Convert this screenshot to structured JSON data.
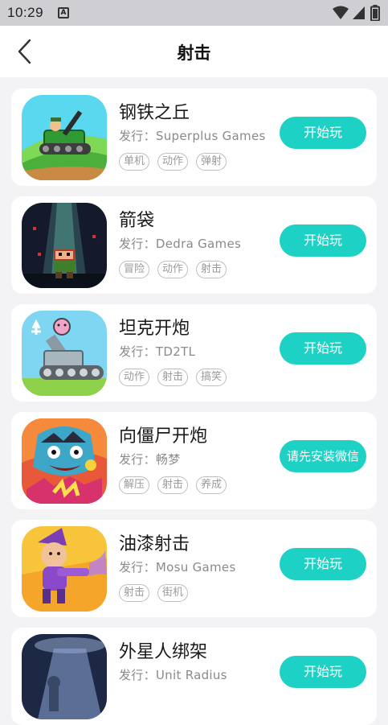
{
  "status": {
    "time": "10:29",
    "notif_letter": "A"
  },
  "nav": {
    "title": "射击"
  },
  "colors": {
    "accent": "#1dd2c4"
  },
  "games": [
    {
      "name": "钢铁之丘",
      "publisher": "发行：Superplus Games",
      "tags": [
        "单机",
        "动作",
        "弹射"
      ],
      "action": "开始玩",
      "icon": "tank-hill-icon"
    },
    {
      "name": "箭袋",
      "publisher": "发行：Dedra Games",
      "tags": [
        "冒险",
        "动作",
        "射击"
      ],
      "action": "开始玩",
      "icon": "pixel-hero-icon"
    },
    {
      "name": "坦克开炮",
      "publisher": "发行：TD2TL",
      "tags": [
        "动作",
        "射击",
        "搞笑"
      ],
      "action": "开始玩",
      "icon": "cannon-tank-icon"
    },
    {
      "name": "向僵尸开炮",
      "publisher": "发行：畅梦",
      "tags": [
        "解压",
        "射击",
        "养成"
      ],
      "action": "请先安装微信",
      "icon": "zombie-icon"
    },
    {
      "name": "油漆射击",
      "publisher": "发行：Mosu Games",
      "tags": [
        "射击",
        "街机"
      ],
      "action": "开始玩",
      "icon": "paint-shooter-icon"
    },
    {
      "name": "外星人绑架",
      "publisher": "发行：Unit Radius",
      "tags": [],
      "action": "开始玩",
      "icon": "ufo-abduction-icon"
    }
  ]
}
